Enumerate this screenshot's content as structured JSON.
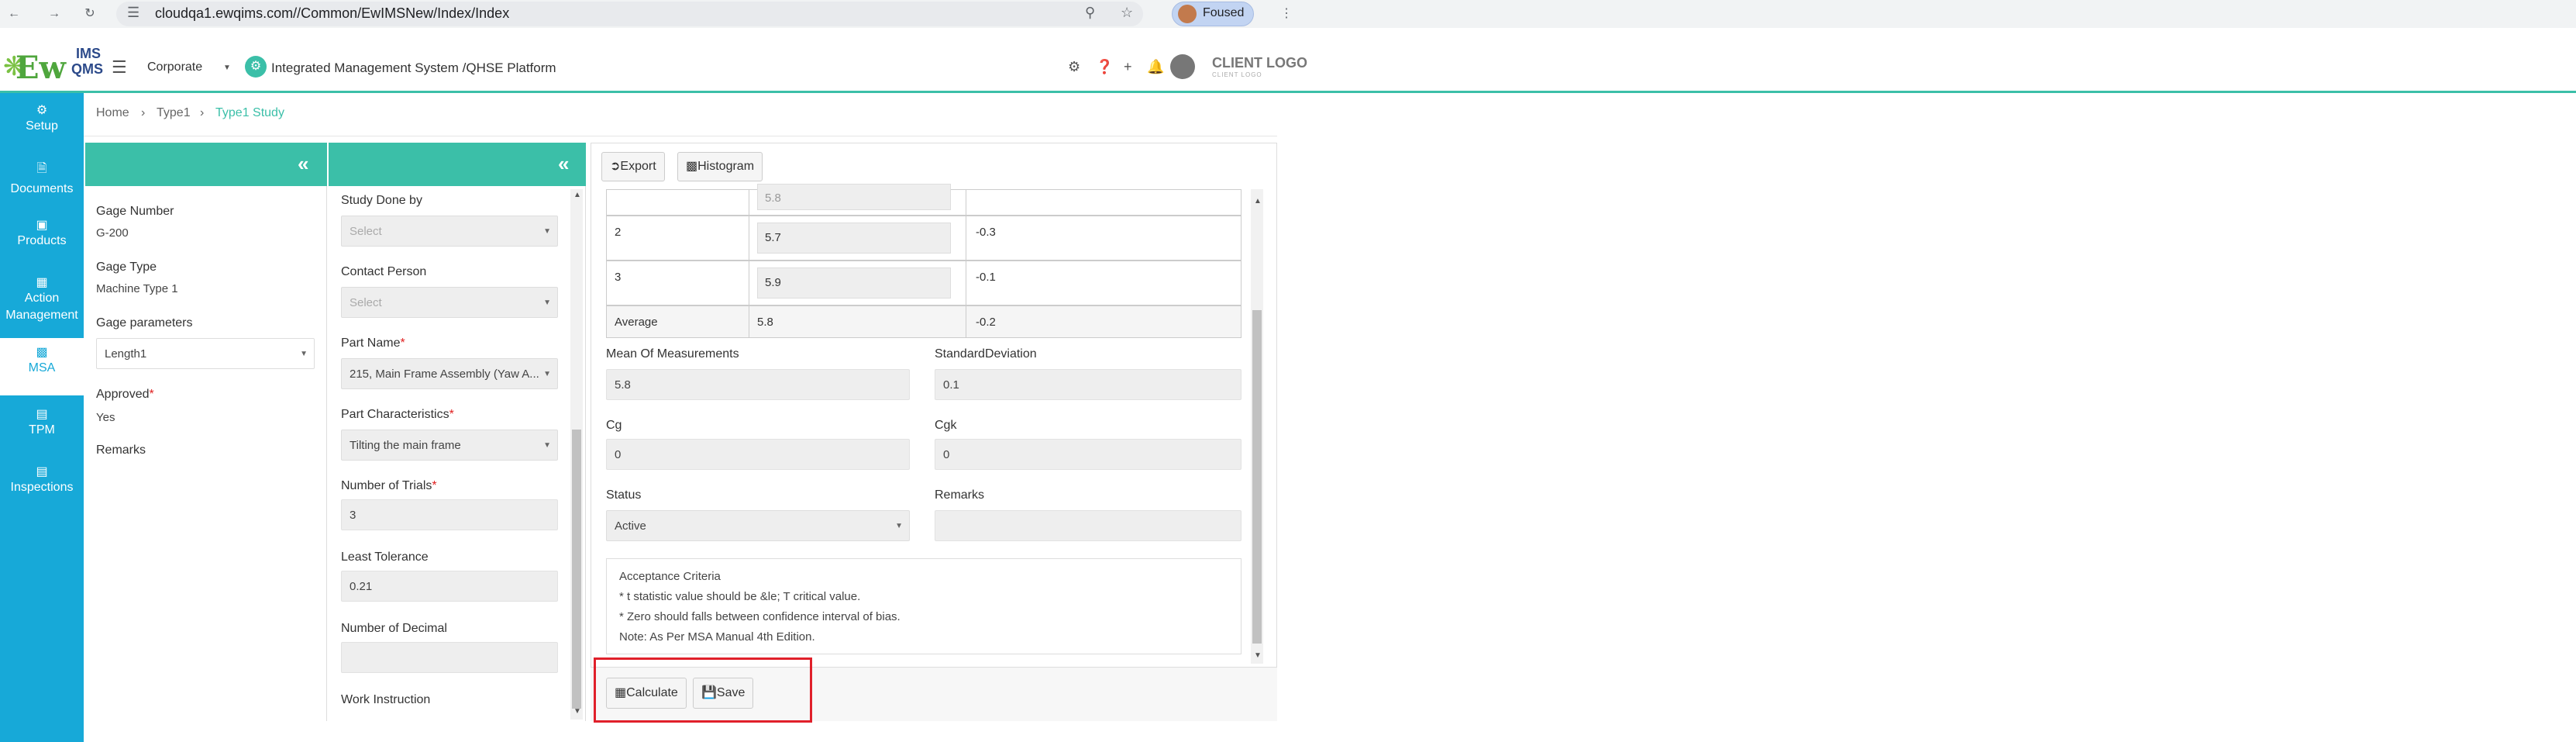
{
  "browser": {
    "url": "cloudqa1.ewqims.com//Common/EwIMSNew/Index/Index",
    "profile": "Foused"
  },
  "header": {
    "logo_main": "Ew",
    "logo_ims": "IMS",
    "logo_qms": "QMS",
    "org_select": "Corporate",
    "platform_title": "Integrated Management System /QHSE Platform",
    "client_logo": "CLIENT LOGO",
    "client_logo_sub": "CLIENT LOGO"
  },
  "sidebar": {
    "items": [
      {
        "label": "Setup",
        "icon": "gears-icon"
      },
      {
        "label": "Documents",
        "icon": "document-icon"
      },
      {
        "label": "Products",
        "icon": "product-icon"
      },
      {
        "label": "Action",
        "label2": "Management",
        "icon": "action-icon"
      },
      {
        "label": "MSA",
        "icon": "chart-icon"
      },
      {
        "label": "TPM",
        "icon": "tpm-icon"
      },
      {
        "label": "Inspections",
        "icon": "inspection-icon"
      }
    ]
  },
  "breadcrumb": {
    "home": "Home",
    "type1": "Type1",
    "current": "Type1 Study"
  },
  "panel1": {
    "gage_number_label": "Gage Number",
    "gage_number": "G-200",
    "gage_type_label": "Gage Type",
    "gage_type": "Machine Type 1",
    "gage_params_label": "Gage parameters",
    "gage_params": "Length1",
    "approved_label": "Approved",
    "approved": "Yes",
    "remarks_label": "Remarks"
  },
  "panel2": {
    "study_done_by_label": "Study Done by",
    "study_done_by_placeholder": "Select",
    "contact_person_label": "Contact Person",
    "contact_person_placeholder": "Select",
    "part_name_label": "Part Name",
    "part_name": "215, Main Frame Assembly (Yaw A...",
    "part_char_label": "Part Characteristics",
    "part_char": "Tilting the main frame",
    "trials_label": "Number of Trials",
    "trials": "3",
    "least_tol_label": "Least Tolerance",
    "least_tol": "0.21",
    "decimal_label": "Number of Decimal",
    "decimal": "",
    "work_instruction_label": "Work Instruction"
  },
  "toolbar": {
    "export": "Export",
    "histogram": "Histogram"
  },
  "table": {
    "rows": [
      {
        "trial": "",
        "measurement": "5.8",
        "bias": ""
      },
      {
        "trial": "2",
        "measurement": "5.7",
        "bias": "-0.3"
      },
      {
        "trial": "3",
        "measurement": "5.9",
        "bias": "-0.1"
      }
    ],
    "average_label": "Average",
    "average_value": "5.8",
    "average_bias": "-0.2"
  },
  "results": {
    "mean_label": "Mean Of Measurements",
    "mean": "5.8",
    "sd_label": "StandardDeviation",
    "sd": "0.1",
    "cg_label": "Cg",
    "cg": "0",
    "cgk_label": "Cgk",
    "cgk": "0",
    "status_label": "Status",
    "status": "Active",
    "remarks_label": "Remarks",
    "remarks": ""
  },
  "criteria": {
    "title": "Acceptance Criteria",
    "line1": "* t statistic value should be &le; T critical value.",
    "line2": "* Zero should falls between confidence interval of bias.",
    "line3": "Note: As Per MSA Manual 4th Edition."
  },
  "footer": {
    "calculate": "Calculate",
    "save": "Save"
  },
  "colors": {
    "teal": "#3bbfa8",
    "sidebar": "#17a9d8",
    "highlight": "#e0202a"
  }
}
